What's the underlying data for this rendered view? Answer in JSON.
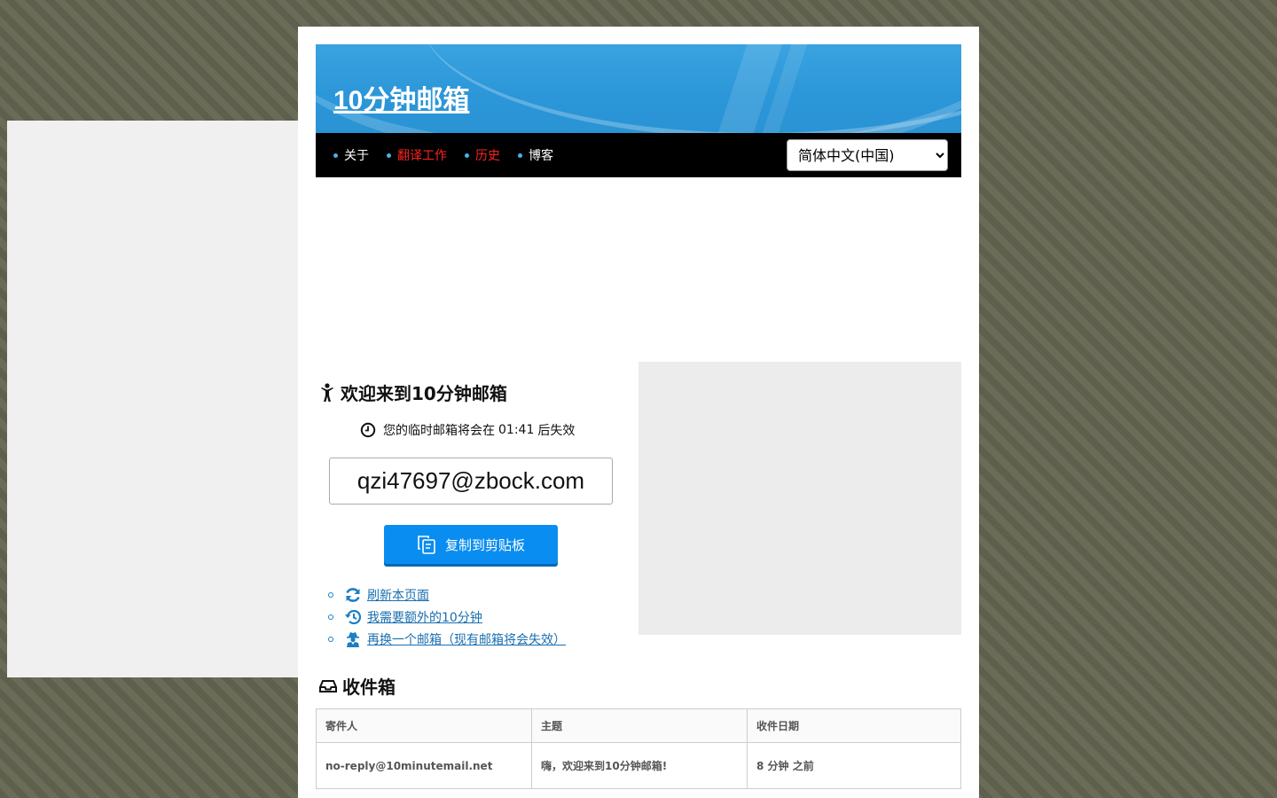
{
  "header": {
    "title": "10分钟邮箱"
  },
  "nav": {
    "items": [
      {
        "label": "关于"
      },
      {
        "label": "翻译工作"
      },
      {
        "label": "历史"
      },
      {
        "label": "博客"
      }
    ],
    "language": "简体中文(中国)"
  },
  "welcome": {
    "title": "欢迎来到10分钟邮箱",
    "timer_prefix": "您的临时邮箱将会在",
    "timer_value": "01:41",
    "timer_suffix": "后失效",
    "email": "qzi47697@zbock.com",
    "copy_label": "复制到剪贴板"
  },
  "links": {
    "refresh": "刷新本页面",
    "extend": "我需要额外的10分钟",
    "new_mail": "再换一个邮箱（现有邮箱将会失效）"
  },
  "inbox": {
    "title": "收件箱",
    "columns": [
      "寄件人",
      "主题",
      "收件日期"
    ],
    "rows": [
      {
        "sender": "no-reply@10minutemail.net",
        "subject": "嗨，欢迎来到10分钟邮箱!",
        "date": "8 分钟 之前"
      }
    ]
  },
  "colors": {
    "accent": "#0a8df0",
    "nav_red": "#ff2222",
    "header_blue": "#2b96d8"
  }
}
